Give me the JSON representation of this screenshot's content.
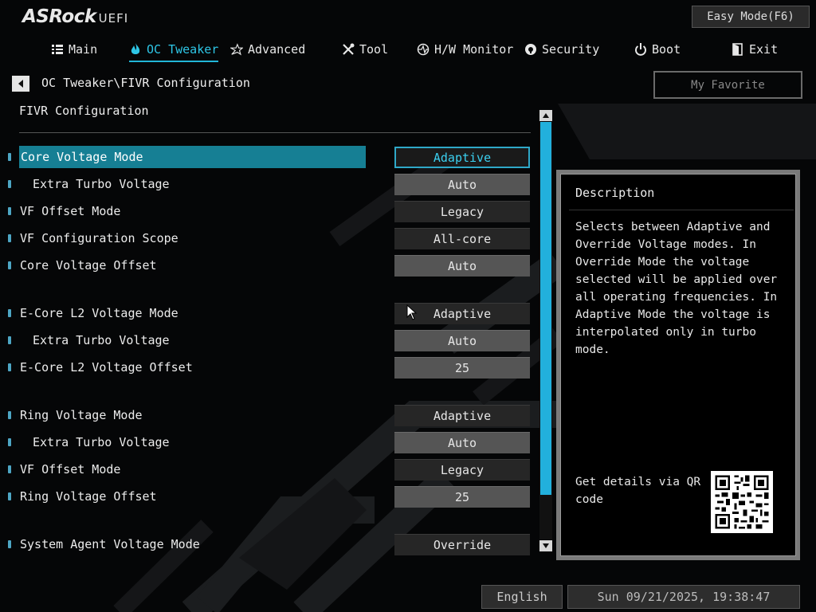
{
  "brand": {
    "logo": "ASRock",
    "logo_sub": "UEFI"
  },
  "header": {
    "easy_mode_label": "Easy Mode(F6)"
  },
  "nav": {
    "items": [
      {
        "label": "Main",
        "icon": "list-icon"
      },
      {
        "label": "OC Tweaker",
        "icon": "flame-icon",
        "active": true
      },
      {
        "label": "Advanced",
        "icon": "star-icon"
      },
      {
        "label": "Tool",
        "icon": "tools-icon"
      },
      {
        "label": "H/W Monitor",
        "icon": "monitor-icon"
      },
      {
        "label": "Security",
        "icon": "shield-icon"
      },
      {
        "label": "Boot",
        "icon": "power-icon"
      },
      {
        "label": "Exit",
        "icon": "exit-icon"
      }
    ]
  },
  "breadcrumb": "OC Tweaker\\FIVR Configuration",
  "my_favorite_label": "My Favorite",
  "section_title": "FIVR Configuration",
  "settings": [
    {
      "label": "Core Voltage Mode",
      "value": "Adaptive",
      "selected": true
    },
    {
      "label": "Extra Turbo Voltage",
      "value": "Auto",
      "indent": true
    },
    {
      "label": "VF Offset Mode",
      "value": "Legacy"
    },
    {
      "label": "VF Configuration Scope",
      "value": "All-core"
    },
    {
      "label": "Core Voltage Offset",
      "value": "Auto"
    },
    {
      "label": "E-Core L2 Voltage Mode",
      "value": "Adaptive"
    },
    {
      "label": "Extra Turbo Voltage",
      "value": "Auto",
      "indent": true
    },
    {
      "label": "E-Core L2 Voltage Offset",
      "value": "25"
    },
    {
      "label": "Ring Voltage Mode",
      "value": "Adaptive"
    },
    {
      "label": "Extra Turbo Voltage",
      "value": "Auto",
      "indent": true
    },
    {
      "label": "VF Offset Mode",
      "value": "Legacy"
    },
    {
      "label": "Ring Voltage Offset",
      "value": "25"
    },
    {
      "label": "System Agent Voltage Mode",
      "value": "Override"
    }
  ],
  "description": {
    "title": "Description",
    "text": "Selects between Adaptive and\nOverride Voltage modes. In\nOverride Mode the voltage\nselected will be applied over\nall operating frequencies. In\nAdaptive Mode the voltage is\ninterpolated only in turbo mode.",
    "qr_text": "Get details via QR code"
  },
  "footer": {
    "language": "English",
    "datetime": "Sun 09/21/2025, 19:38:47"
  },
  "colors": {
    "accent": "#22b6d8",
    "selected_row": "#167f94"
  }
}
